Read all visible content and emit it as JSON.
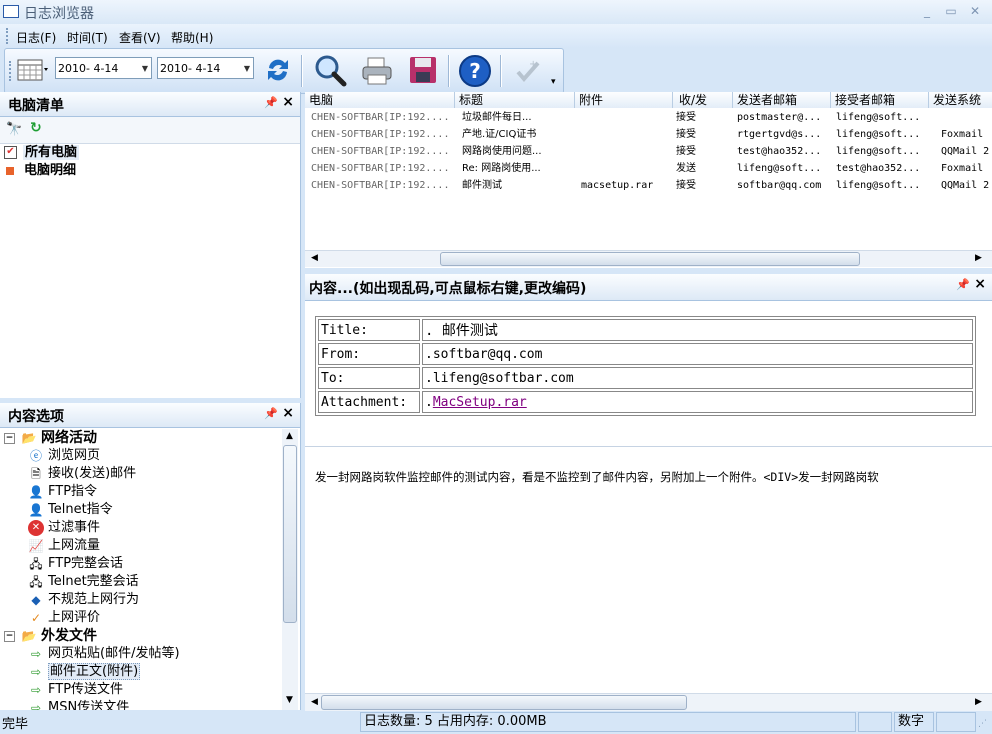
{
  "window": {
    "title": "日志浏览器"
  },
  "menu": [
    {
      "label": "日志(F)"
    },
    {
      "label": "时间(T)"
    },
    {
      "label": "查看(V)"
    },
    {
      "label": "帮助(H)"
    }
  ],
  "toolbar": {
    "date_from": "2010- 4-14",
    "date_to": "2010- 4-14"
  },
  "computers_panel": {
    "title": "电脑清单",
    "items": [
      {
        "label": "所有电脑",
        "checked": true
      },
      {
        "label": "电脑明细"
      }
    ]
  },
  "content_panel": {
    "title": "内容选项",
    "groups": [
      {
        "label": "网络活动",
        "items": [
          {
            "label": "浏览网页",
            "icon": "ie-icon"
          },
          {
            "label": "接收(发送)邮件",
            "icon": "mail-icon"
          },
          {
            "label": "FTP指令",
            "icon": "user-icon"
          },
          {
            "label": "Telnet指令",
            "icon": "user-icon"
          },
          {
            "label": "过滤事件",
            "icon": "block-icon"
          },
          {
            "label": "上网流量",
            "icon": "chart-icon"
          },
          {
            "label": "FTP完整会话",
            "icon": "session-icon"
          },
          {
            "label": "Telnet完整会话",
            "icon": "session-icon"
          },
          {
            "label": "不规范上网行为",
            "icon": "diamond-icon"
          },
          {
            "label": "上网评价",
            "icon": "check-icon"
          }
        ]
      },
      {
        "label": "外发文件",
        "items": [
          {
            "label": "网页粘贴(邮件/发帖等)",
            "icon": "file-arrow-icon"
          },
          {
            "label": "邮件正文(附件)",
            "icon": "file-arrow-icon",
            "selected": true
          },
          {
            "label": "FTP传送文件",
            "icon": "file-arrow-icon"
          },
          {
            "label": "MSN传送文件",
            "icon": "file-arrow-icon"
          }
        ]
      }
    ]
  },
  "log_table": {
    "columns": [
      "电脑",
      "标题",
      "附件",
      "收/发",
      "发送者邮箱",
      "接受者邮箱",
      "发送系统"
    ],
    "rows": [
      [
        "CHEN-SOFTBAR[IP:192....",
        " 垃圾邮件每日...",
        "",
        "接受",
        "postmaster@...",
        "lifeng@soft...",
        ""
      ],
      [
        "CHEN-SOFTBAR[IP:192....",
        "产地.证/CIQ证书",
        "",
        "接受",
        "rtgertgvd@s...",
        "lifeng@soft...",
        "Foxmail"
      ],
      [
        "CHEN-SOFTBAR[IP:192....",
        "网路岗使用问题...",
        "",
        "接受",
        "test@hao352...",
        "lifeng@soft...",
        "QQMail 2"
      ],
      [
        "CHEN-SOFTBAR[IP:192....",
        "Re: 网路岗使用...",
        "",
        "发送",
        "lifeng@soft...",
        "test@hao352...",
        "Foxmail"
      ],
      [
        "CHEN-SOFTBAR[IP:192....",
        "邮件测试",
        "macsetup.rar",
        "接受",
        "softbar@qq.com",
        "lifeng@soft...",
        "QQMail 2"
      ]
    ]
  },
  "detail_panel": {
    "title": "内容...(如出现乱码,可点鼠标右键,更改编码)",
    "fields": [
      {
        "label": "Title:",
        "value": ". 邮件测试"
      },
      {
        "label": "From:",
        "value": ".softbar@qq.com"
      },
      {
        "label": "To:",
        "value": ".lifeng@softbar.com"
      },
      {
        "label": "Attachment:",
        "value_prefix": ".",
        "link": "MacSetup.rar"
      }
    ],
    "body": "发一封网路岗软件监控邮件的测试内容，看是不监控到了邮件内容，另附加上一个附件。<DIV>发一封网路岗软"
  },
  "statusbar": {
    "left": "完毕",
    "count": "日志数量: 5  占用内存: 0.00MB",
    "mode": "数字"
  },
  "colors": {
    "accent": "#d6e6f7",
    "link": "#800080"
  }
}
